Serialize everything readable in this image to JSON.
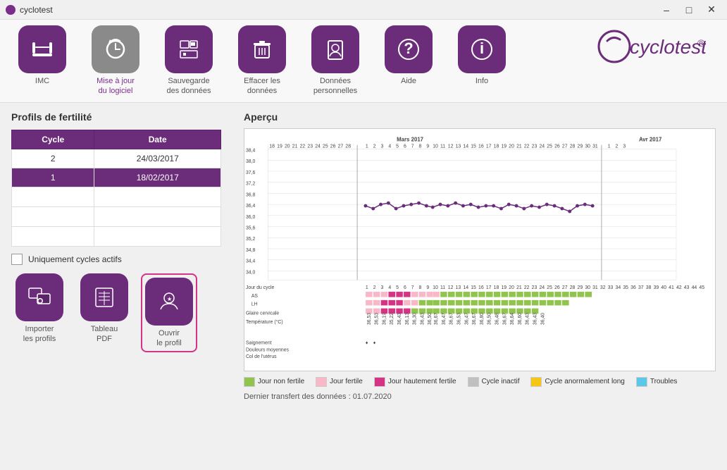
{
  "window": {
    "title": "cyclotest",
    "min": "–",
    "max": "□",
    "close": "✕"
  },
  "toolbar": {
    "items": [
      {
        "id": "imc",
        "label": "IMC",
        "icon": "📏",
        "active": false
      },
      {
        "id": "mise-a-jour",
        "label": "Mise à jour\ndu logiciel",
        "icon": "🔄",
        "active": true
      },
      {
        "id": "sauvegarde",
        "label": "Sauvegarde\ndes données",
        "icon": "💾",
        "active": false
      },
      {
        "id": "effacer",
        "label": "Effacer les\ndonnées",
        "icon": "🗑️",
        "active": false
      },
      {
        "id": "donnees",
        "label": "Données\npersonnelles",
        "icon": "👤",
        "active": false
      },
      {
        "id": "aide",
        "label": "Aide",
        "icon": "❓",
        "active": false
      },
      {
        "id": "info",
        "label": "Info",
        "icon": "ℹ️",
        "active": false
      }
    ]
  },
  "left_panel": {
    "title": "Profils de fertilité",
    "table": {
      "headers": [
        "Cycle",
        "Date"
      ],
      "rows": [
        {
          "cycle": "2",
          "date": "24/03/2017",
          "selected": false
        },
        {
          "cycle": "1",
          "date": "18/02/2017",
          "selected": true
        },
        {
          "cycle": "",
          "date": "",
          "selected": false
        },
        {
          "cycle": "",
          "date": "",
          "selected": false
        },
        {
          "cycle": "",
          "date": "",
          "selected": false
        }
      ]
    },
    "checkbox_label": "Uniquement cycles actifs",
    "buttons": [
      {
        "id": "importer",
        "label": "Importer\nles profils",
        "icon": "🖥️"
      },
      {
        "id": "tableau",
        "label": "Tableau\nPDF",
        "icon": "📅"
      },
      {
        "id": "ouvrir",
        "label": "Ouvrir\nle profil",
        "icon": "👶",
        "highlighted": true
      }
    ]
  },
  "right_panel": {
    "title": "Aperçu",
    "legend": [
      {
        "color": "#90c44e",
        "label": "Jour non fertile"
      },
      {
        "color": "#f9b8c8",
        "label": "Jour fertile"
      },
      {
        "color": "#d63384",
        "label": "Jour hautement\nfertile"
      },
      {
        "color": "#c0c0c0",
        "label": "Cycle inactif"
      },
      {
        "color": "#f5c518",
        "label": "Cycle anormalement\nlong"
      },
      {
        "color": "#5bc8e8",
        "label": "Troubles"
      }
    ],
    "footer": "Dernier transfert des données : 01.07.2020",
    "chart": {
      "months": [
        "Mars 2017",
        "Avr 2017"
      ],
      "temp_range": {
        "min": 34.0,
        "max": 38.4
      },
      "y_labels": [
        "38,4",
        "38,0",
        "37,6",
        "37,2",
        "36,8",
        "36,4",
        "36,0",
        "35,6",
        "35,2",
        "34,8",
        "34,4",
        "34,0"
      ],
      "row_labels": [
        "Jour du cycle",
        "AS",
        "LH",
        "Glaire cervicale",
        "Température (°C)",
        "Saignement",
        "Douleurs moyennes",
        "Col de l'utérus"
      ]
    }
  }
}
